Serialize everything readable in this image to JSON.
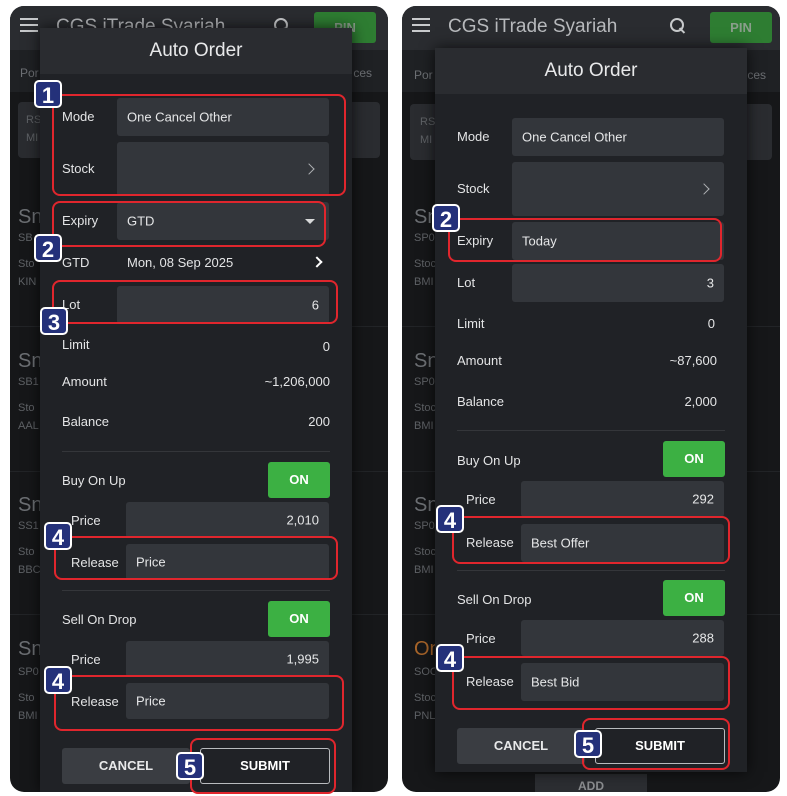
{
  "app": {
    "title": "CGS iTrade Syariah",
    "pin_label": "PIN",
    "tab_left": "Por",
    "tab_right": "ces",
    "add_label": "ADD"
  },
  "colors": {
    "on_toggle": "#3cb043",
    "annotation": "#e0262d",
    "badge": "#24317a"
  },
  "icons": [
    "menu-icon",
    "search-icon",
    "chevron-right-icon",
    "caret-down-icon"
  ],
  "left": {
    "dialog_title": "Auto Order",
    "mode_label": "Mode",
    "mode_value": "One Cancel Other",
    "stock_label": "Stock",
    "stock_value": "",
    "expiry_label": "Expiry",
    "expiry_value": "GTD",
    "gtd_label": "GTD",
    "gtd_value": "Mon, 08 Sep 2025",
    "lot_label": "Lot",
    "lot_value": "6",
    "limit_label": "Limit",
    "limit_value": "0",
    "amount_label": "Amount",
    "amount_value": "~1,206,000",
    "balance_label": "Balance",
    "balance_value": "200",
    "buy_label": "Buy On Up",
    "buy_toggle": "ON",
    "buy_price_label": "Price",
    "buy_price_value": "2,010",
    "buy_release_label": "Release",
    "buy_release_value": "Price",
    "sell_label": "Sell On Drop",
    "sell_toggle": "ON",
    "sell_price_label": "Price",
    "sell_price_value": "1,995",
    "sell_release_label": "Release",
    "sell_release_value": "Price",
    "cancel_label": "CANCEL",
    "submit_label": "SUBMIT",
    "bg": {
      "rs": "RS",
      "mi": "MI",
      "sn": "Sn",
      "sb": "SB",
      "sb1": "SB1",
      "ss1": "SS1",
      "sp": "SP0",
      "sto": "Sto",
      "kin": "KIN",
      "aal": "AAL",
      "bbc": "BBC",
      "bmi": "BMI"
    }
  },
  "right": {
    "dialog_title": "Auto Order",
    "mode_label": "Mode",
    "mode_value": "One Cancel Other",
    "stock_label": "Stock",
    "stock_value": "",
    "expiry_label": "Expiry",
    "expiry_value": "Today",
    "lot_label": "Lot",
    "lot_value": "3",
    "limit_label": "Limit",
    "limit_value": "0",
    "amount_label": "Amount",
    "amount_value": "~87,600",
    "balance_label": "Balance",
    "balance_value": "2,000",
    "buy_label": "Buy On Up",
    "buy_toggle": "ON",
    "buy_price_label": "Price",
    "buy_price_value": "292",
    "buy_release_label": "Release",
    "buy_release_value": "Best Offer",
    "sell_label": "Sell On Drop",
    "sell_toggle": "ON",
    "sell_price_label": "Price",
    "sell_price_value": "288",
    "sell_release_label": "Release",
    "sell_release_value": "Best Bid",
    "cancel_label": "CANCEL",
    "submit_label": "SUBMIT",
    "bg": {
      "rs": "RS",
      "mi": "MI",
      "sn": "Sn",
      "sp": "SP0",
      "sto": "Stoc",
      "bmi": "BMI",
      "on": "On",
      "soo": "SOO",
      "pnl": "PNL"
    }
  },
  "annotations": [
    "1",
    "2",
    "3",
    "4",
    "4",
    "5",
    "2",
    "4",
    "4",
    "5"
  ]
}
